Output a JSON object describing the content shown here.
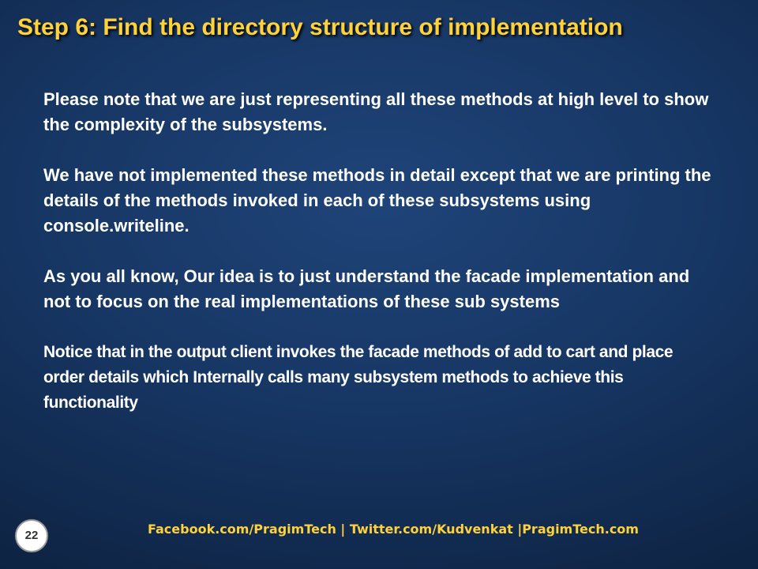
{
  "slide": {
    "title": "Step 6:  Find the directory structure of implementation",
    "paragraphs": [
      "Please note that we are just representing all these methods at high level to show the complexity of the subsystems.",
      "We have not implemented these methods in detail except that we are printing the details of the methods invoked in each of these subsystems using console.writeline.",
      "As you all know, Our idea is to just understand the facade implementation and not to focus on the real implementations of these sub systems",
      "Notice that  in the output  client invokes the facade methods of add to cart and place order details which  Internally calls many subsystem methods to achieve this functionality"
    ],
    "footer": "Facebook.com/PragimTech  | Twitter.com/Kudvenkat  |PragimTech.com",
    "page_number": "22"
  },
  "colors": {
    "title": "#ffd23a",
    "body_text": "#ffffff",
    "footer": "#ffd23a",
    "background": "#173765"
  }
}
